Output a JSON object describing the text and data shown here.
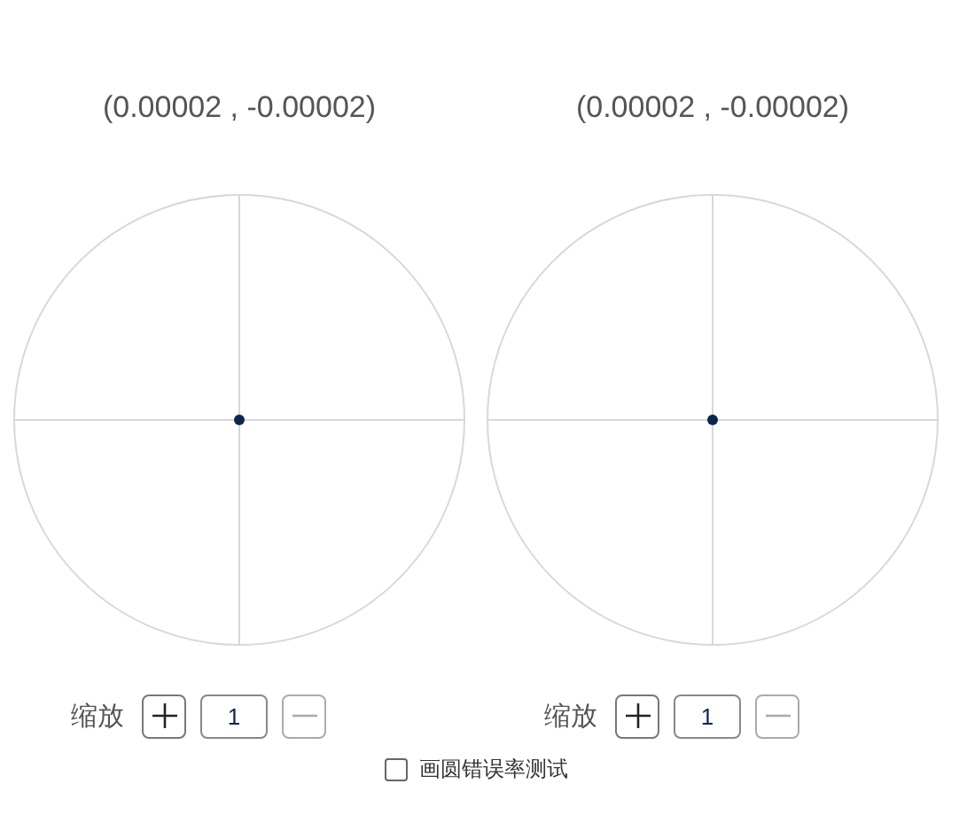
{
  "panels": [
    {
      "coordinates": "(0.00002 , -0.00002)",
      "zoom_label": "缩放",
      "zoom_value": "1",
      "zoom_in_disabled": false,
      "zoom_out_disabled": true
    },
    {
      "coordinates": "(0.00002 , -0.00002)",
      "zoom_label": "缩放",
      "zoom_value": "1",
      "zoom_in_disabled": false,
      "zoom_out_disabled": true
    }
  ],
  "test_option": {
    "label": "画圆错误率测试",
    "checked": false
  }
}
